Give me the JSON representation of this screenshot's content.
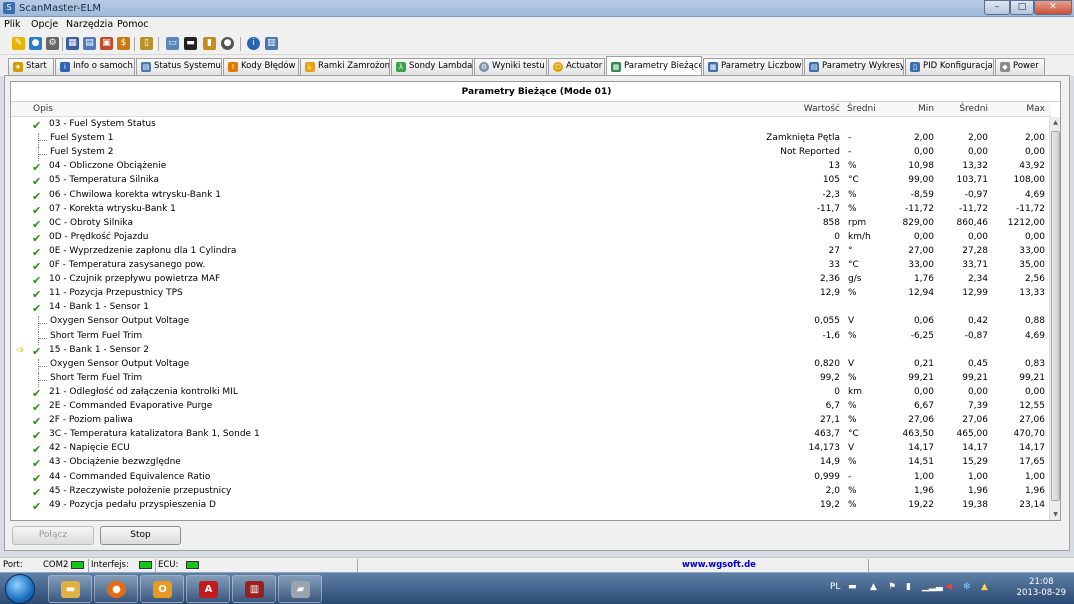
{
  "window": {
    "title": "ScanMaster-ELM"
  },
  "menu": [
    "Plik",
    "Opcje",
    "Narzędzia",
    "Pomoc"
  ],
  "tabs": [
    {
      "label": "Start",
      "icon": "start-icon"
    },
    {
      "label": "Info o samoch.",
      "icon": "info-icon"
    },
    {
      "label": "Status Systemu",
      "icon": "status-icon"
    },
    {
      "label": "Kody Błędów",
      "icon": "warning-icon"
    },
    {
      "label": "Ramki Zamrożone",
      "icon": "freeze-frame-icon"
    },
    {
      "label": "Sondy Lambda",
      "icon": "lambda-icon"
    },
    {
      "label": "Wyniki testu",
      "icon": "test-results-icon"
    },
    {
      "label": "Actuator",
      "icon": "actuator-icon"
    },
    {
      "label": "Parametry Bieżące",
      "icon": "live-data-icon",
      "active": true
    },
    {
      "label": "Parametry Liczbowe",
      "icon": "numeric-icon"
    },
    {
      "label": "Parametry Wykresy",
      "icon": "graph-icon"
    },
    {
      "label": "PID Konfiguracja",
      "icon": "pid-config-icon"
    },
    {
      "label": "Power",
      "icon": "power-icon"
    }
  ],
  "grid": {
    "title": "Parametry Bieżące (Mode 01)",
    "headers": {
      "desc": "Opis",
      "value": "Wartość",
      "unit": "Średni",
      "min": "Min",
      "avg": "Średni",
      "max": "Max"
    },
    "rows": [
      {
        "level": 0,
        "check": true,
        "desc": "03 - Fuel System Status",
        "value": "",
        "unit": "",
        "min": "",
        "avg": "",
        "max": ""
      },
      {
        "level": 1,
        "check": false,
        "desc": "Fuel System 1",
        "value": "Zamknięta Pętla",
        "unit": "-",
        "min": "2,00",
        "avg": "2,00",
        "max": "2,00"
      },
      {
        "level": 1,
        "check": false,
        "desc": "Fuel System 2",
        "value": "Not Reported",
        "unit": "-",
        "min": "0,00",
        "avg": "0,00",
        "max": "0,00"
      },
      {
        "level": 0,
        "check": true,
        "desc": "04 - Obliczone Obciążenie",
        "value": "13",
        "unit": "%",
        "min": "10,98",
        "avg": "13,32",
        "max": "43,92"
      },
      {
        "level": 0,
        "check": true,
        "desc": "05 - Temperatura Silnika",
        "value": "105",
        "unit": "°C",
        "min": "99,00",
        "avg": "103,71",
        "max": "108,00"
      },
      {
        "level": 0,
        "check": true,
        "desc": "06 - Chwilowa korekta wtrysku-Bank 1",
        "value": "-2,3",
        "unit": "%",
        "min": "-8,59",
        "avg": "-0,97",
        "max": "4,69"
      },
      {
        "level": 0,
        "check": true,
        "desc": "07 - Korekta wtrysku-Bank 1",
        "value": "-11,7",
        "unit": "%",
        "min": "-11,72",
        "avg": "-11,72",
        "max": "-11,72"
      },
      {
        "level": 0,
        "check": true,
        "desc": "0C - Obroty Silnika",
        "value": "858",
        "unit": "rpm",
        "min": "829,00",
        "avg": "860,46",
        "max": "1212,00"
      },
      {
        "level": 0,
        "check": true,
        "desc": "0D - Prędkość Pojazdu",
        "value": "0",
        "unit": "km/h",
        "min": "0,00",
        "avg": "0,00",
        "max": "0,00"
      },
      {
        "level": 0,
        "check": true,
        "desc": "0E - Wyprzedzenie zapłonu dla 1 Cylindra",
        "value": "27",
        "unit": "°",
        "min": "27,00",
        "avg": "27,28",
        "max": "33,00"
      },
      {
        "level": 0,
        "check": true,
        "desc": "0F - Temperatura zasysanego pow.",
        "value": "33",
        "unit": "°C",
        "min": "33,00",
        "avg": "33,71",
        "max": "35,00"
      },
      {
        "level": 0,
        "check": true,
        "desc": "10 - Czujnik przepływu powietrza MAF",
        "value": "2,36",
        "unit": "g/s",
        "min": "1,76",
        "avg": "2,34",
        "max": "2,56"
      },
      {
        "level": 0,
        "check": true,
        "desc": "11 - Pozycja Przepustnicy TPS",
        "value": "12,9",
        "unit": "%",
        "min": "12,94",
        "avg": "12,99",
        "max": "13,33"
      },
      {
        "level": 0,
        "check": true,
        "desc": "14 - Bank 1 - Sensor 1",
        "value": "",
        "unit": "",
        "min": "",
        "avg": "",
        "max": ""
      },
      {
        "level": 1,
        "check": false,
        "desc": "Oxygen Sensor Output Voltage",
        "value": "0,055",
        "unit": "V",
        "min": "0,06",
        "avg": "0,42",
        "max": "0,88"
      },
      {
        "level": 1,
        "check": false,
        "desc": "Short Term Fuel Trim",
        "value": "-1,6",
        "unit": "%",
        "min": "-6,25",
        "avg": "-0,87",
        "max": "4,69"
      },
      {
        "level": 0,
        "check": true,
        "arrow": true,
        "desc": "15 - Bank 1 - Sensor 2",
        "value": "",
        "unit": "",
        "min": "",
        "avg": "",
        "max": ""
      },
      {
        "level": 1,
        "check": false,
        "desc": "Oxygen Sensor Output Voltage",
        "value": "0,820",
        "unit": "V",
        "min": "0,21",
        "avg": "0,45",
        "max": "0,83"
      },
      {
        "level": 1,
        "check": false,
        "desc": "Short Term Fuel Trim",
        "value": "99,2",
        "unit": "%",
        "min": "99,21",
        "avg": "99,21",
        "max": "99,21"
      },
      {
        "level": 0,
        "check": true,
        "desc": "21 - Odległość od załączenia kontrolki MIL",
        "value": "0",
        "unit": "km",
        "min": "0,00",
        "avg": "0,00",
        "max": "0,00"
      },
      {
        "level": 0,
        "check": true,
        "desc": "2E - Commanded Evaporative Purge",
        "value": "6,7",
        "unit": "%",
        "min": "6,67",
        "avg": "7,39",
        "max": "12,55"
      },
      {
        "level": 0,
        "check": true,
        "desc": "2F - Poziom paliwa",
        "value": "27,1",
        "unit": "%",
        "min": "27,06",
        "avg": "27,06",
        "max": "27,06"
      },
      {
        "level": 0,
        "check": true,
        "desc": "3C - Temperatura katalizatora Bank 1, Sonde 1",
        "value": "463,7",
        "unit": "°C",
        "min": "463,50",
        "avg": "465,00",
        "max": "470,70"
      },
      {
        "level": 0,
        "check": true,
        "desc": "42 - Napięcie ECU",
        "value": "14,173",
        "unit": "V",
        "min": "14,17",
        "avg": "14,17",
        "max": "14,17"
      },
      {
        "level": 0,
        "check": true,
        "desc": "43 - Obciążenie bezwzględne",
        "value": "14,9",
        "unit": "%",
        "min": "14,51",
        "avg": "15,29",
        "max": "17,65"
      },
      {
        "level": 0,
        "check": true,
        "desc": "44 - Commanded Equivalence Ratio",
        "value": "0,999",
        "unit": "-",
        "min": "1,00",
        "avg": "1,00",
        "max": "1,00"
      },
      {
        "level": 0,
        "check": true,
        "desc": "45 - Rzeczywiste położenie przepustnicy",
        "value": "2,0",
        "unit": "%",
        "min": "1,96",
        "avg": "1,96",
        "max": "1,96"
      },
      {
        "level": 0,
        "check": true,
        "desc": "49 - Pozycja pedału przyspieszenia D",
        "value": "19,2",
        "unit": "%",
        "min": "19,22",
        "avg": "19,38",
        "max": "23,14"
      }
    ]
  },
  "buttons": {
    "connect": "Połącz",
    "stop": "Stop"
  },
  "statusbar": {
    "port_label": "Port:",
    "port_value": "COM2",
    "interface_label": "Interfejs:",
    "ecu_label": "ECU:",
    "website": "www.wgsoft.de"
  },
  "taskbar": {
    "lang": "PL",
    "time": "21:08",
    "date": "2013-08-29"
  },
  "colors": {
    "check": "#2c8a16",
    "led": "#17c417",
    "link": "#0000cc"
  }
}
